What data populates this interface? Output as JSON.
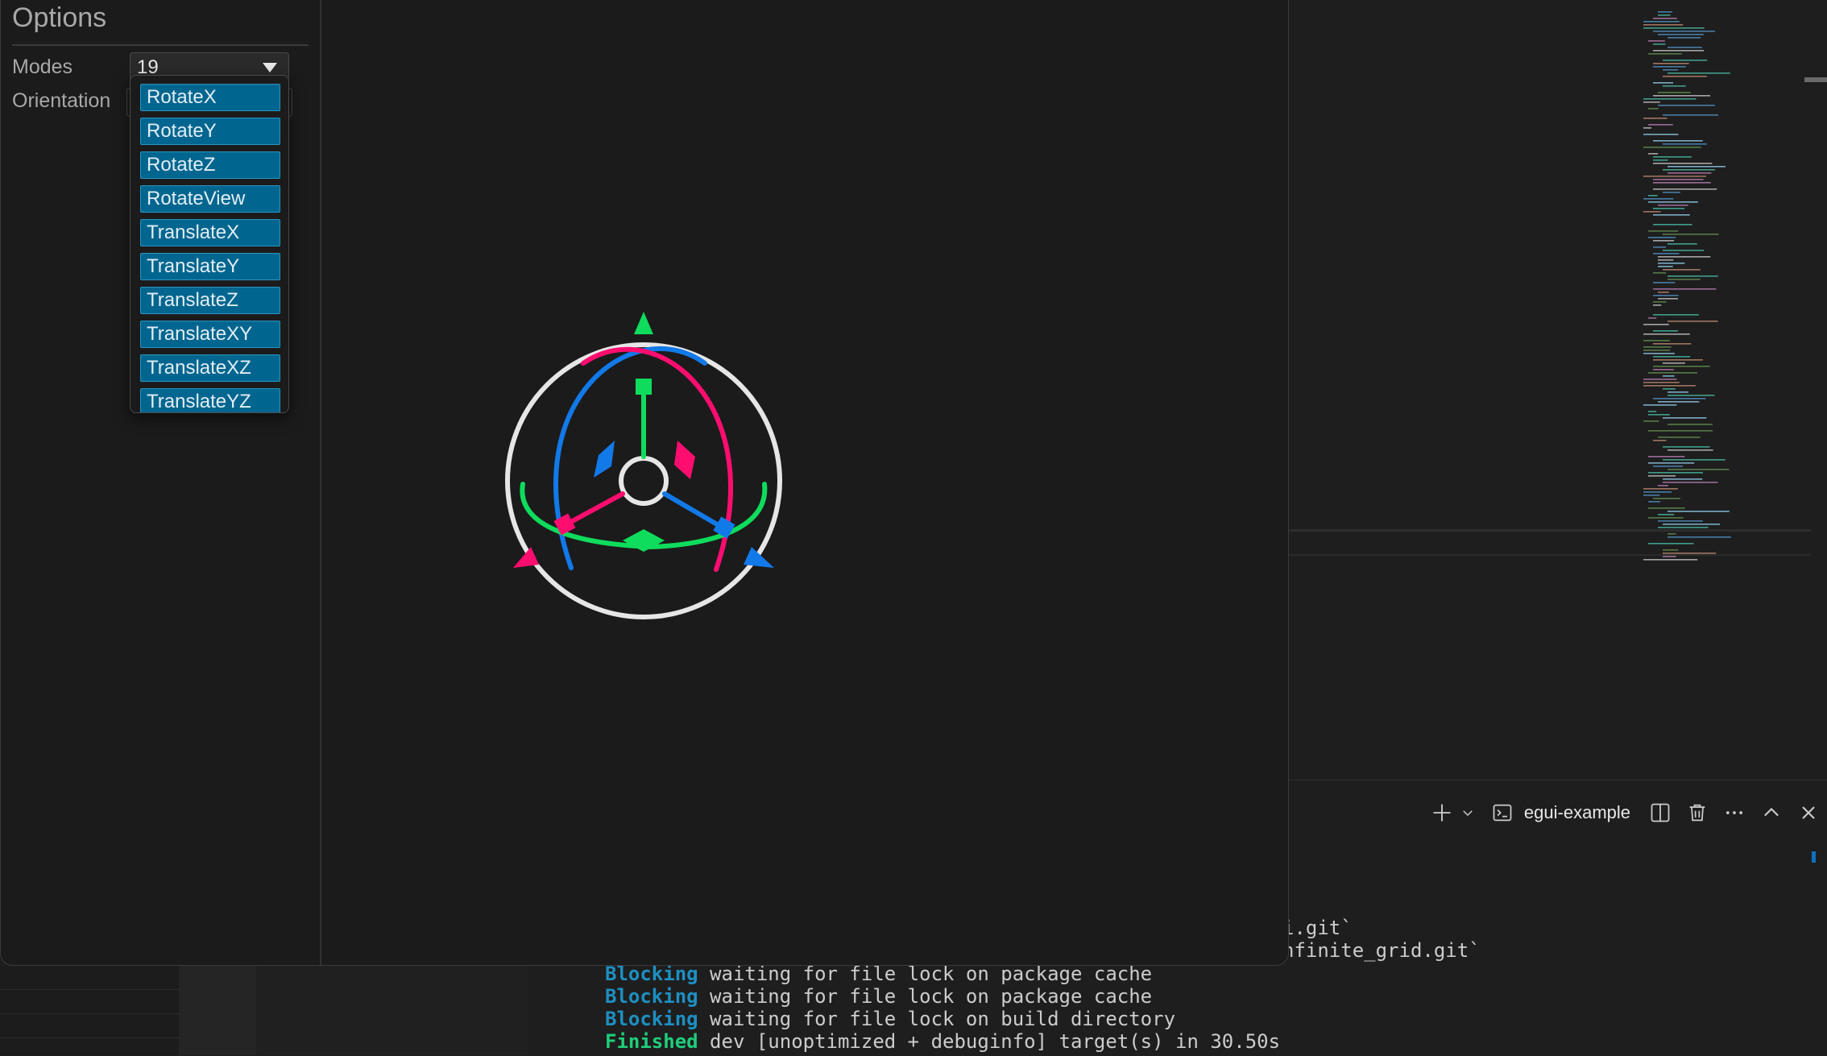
{
  "app": {
    "options_title": "Options",
    "modes_label": "Modes",
    "orientation_label": "Orientation",
    "modes_selected": "19",
    "modes_dropdown_items": [
      "RotateX",
      "RotateY",
      "RotateZ",
      "RotateView",
      "TranslateX",
      "TranslateY",
      "TranslateZ",
      "TranslateXY",
      "TranslateXZ",
      "TranslateYZ"
    ]
  },
  "gizmo_colors": {
    "x_axis": "#ff0d6f",
    "y_axis": "#0fdc5c",
    "z_axis": "#1279e8",
    "view_ring": "#e6e6e6"
  },
  "terminal": {
    "tab_label": "egui-example",
    "icons": [
      "plus-icon",
      "chevron-down-icon",
      "terminal-icon",
      "split-icon",
      "trash-icon",
      "more-icon",
      "chevron-up-icon",
      "close-icon"
    ],
    "lines": [
      {
        "text": "i.git`"
      },
      {
        "text": "nfinite_grid.git`"
      },
      {
        "status": "Blocking",
        "rest": " waiting for file lock on package cache"
      },
      {
        "status": "Blocking",
        "rest": " waiting for file lock on package cache"
      },
      {
        "status": "Blocking",
        "rest": " waiting for file lock on build directory"
      },
      {
        "status": "Finished",
        "rest": " dev [unoptimized + debuginfo] target(s) in 30.50s"
      }
    ]
  }
}
